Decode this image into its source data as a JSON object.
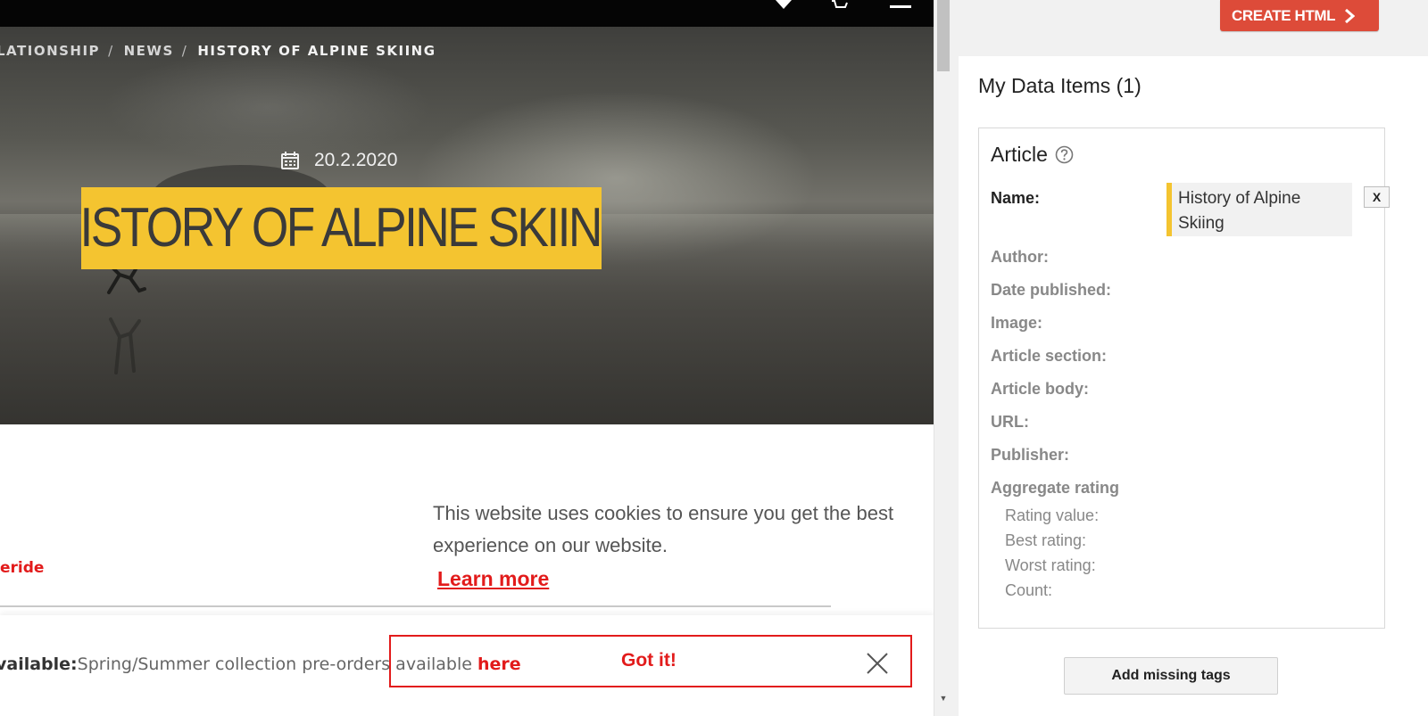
{
  "site": {
    "breadcrumb": [
      {
        "label": "LATIONSHIP"
      },
      {
        "label": "NEWS"
      },
      {
        "label": "HISTORY OF ALPINE SKIING"
      }
    ],
    "breadcrumb_separator": "/",
    "post_date": "20.2.2020",
    "title": "HISTORY OF ALPINE SKIING",
    "override_link": "eride",
    "cookie": {
      "message": "This website uses cookies to ensure you get the best experience on our website.",
      "learn_more": "Learn more",
      "accept": "Got it!"
    },
    "notice": {
      "label": "vailable:",
      "message": "Spring/Summer collection pre-orders available ",
      "link": "here"
    },
    "colors": {
      "accent_red": "#e21b1b",
      "title_yellow": "#f4c430"
    },
    "icons": [
      "heart-icon",
      "cart-icon",
      "menu-icon",
      "calendar-icon",
      "close-icon"
    ]
  },
  "panel": {
    "create_html": "CREATE HTML",
    "title": "My Data Items (1)",
    "article": {
      "heading": "Article",
      "name_label": "Name:",
      "name_value": "History of Alpine Skiing",
      "remove_label": "X",
      "fields": {
        "author": "Author:",
        "date_published": "Date published:",
        "image": "Image:",
        "article_section": "Article section:",
        "article_body": "Article body:",
        "url": "URL:",
        "publisher": "Publisher:",
        "aggregate_rating": "Aggregate rating"
      },
      "rating_fields": {
        "rating_value": "Rating value:",
        "best_rating": "Best rating:",
        "worst_rating": "Worst rating:",
        "count": "Count:"
      }
    },
    "add_missing_tags": "Add missing tags",
    "colors": {
      "create_button": "#dd4b39"
    }
  }
}
